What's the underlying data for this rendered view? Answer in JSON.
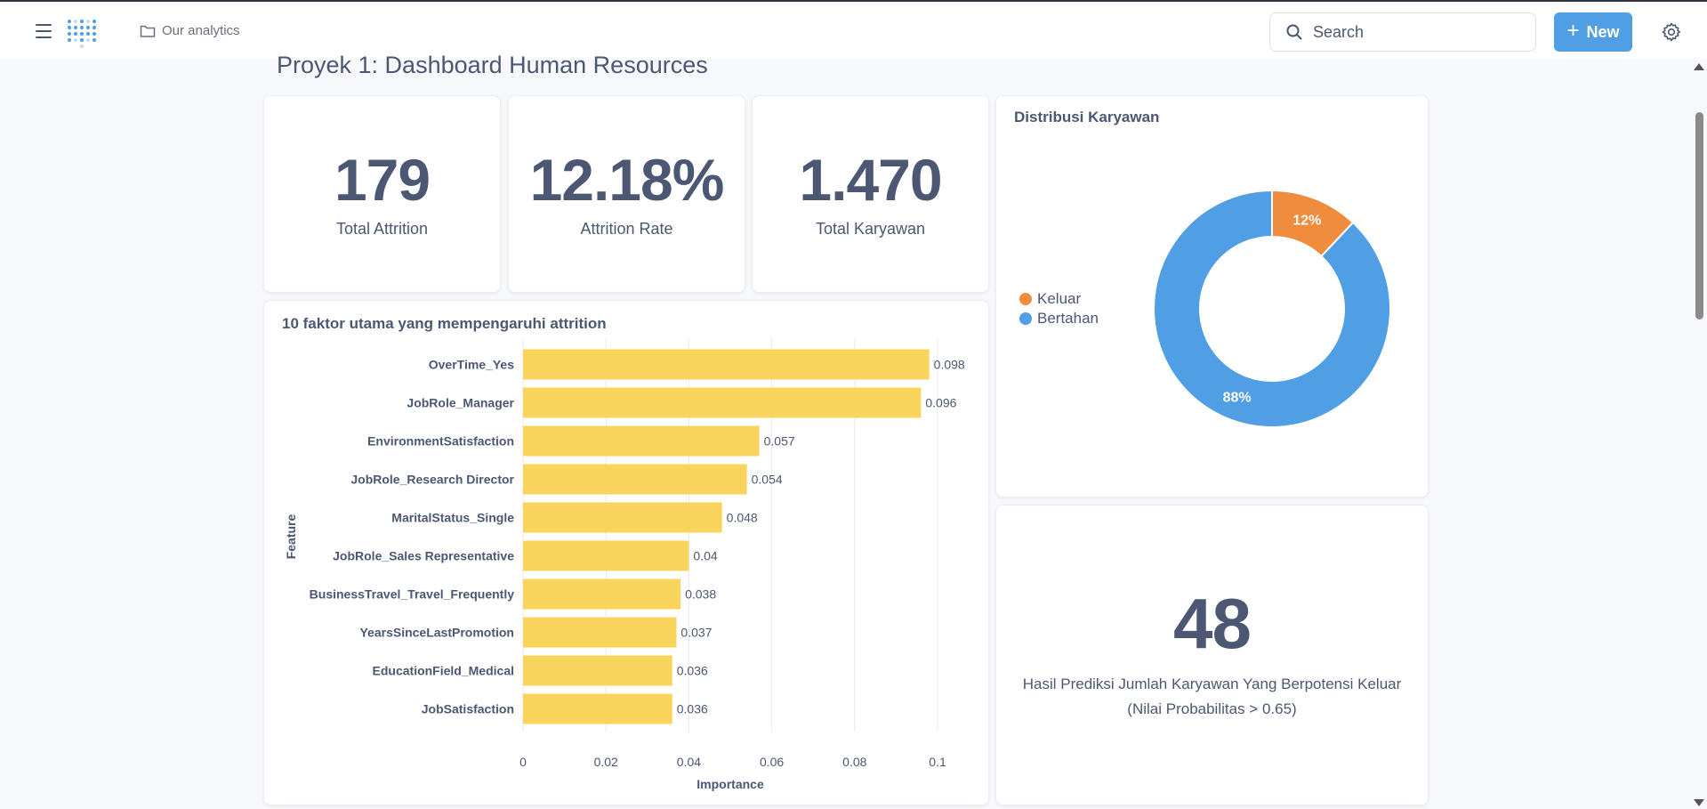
{
  "topbar": {
    "breadcrumb": "Our analytics",
    "search_placeholder": "Search",
    "new_label": "New"
  },
  "dashboard": {
    "title": "Proyek 1: Dashboard Human Resources"
  },
  "kpis": [
    {
      "value": "179",
      "label": "Total Attrition"
    },
    {
      "value": "12.18%",
      "label": "Attrition Rate"
    },
    {
      "value": "1.470",
      "label": "Total Karyawan"
    }
  ],
  "prediction": {
    "value": "48",
    "label_line1": "Hasil Prediksi Jumlah Karyawan Yang Berpotensi Keluar",
    "label_line2": "(Nilai Probabilitas > 0.65)"
  },
  "colors": {
    "bar": "#f9d45c",
    "keluar": "#f08c3d",
    "bertahan": "#509ee3",
    "accent": "#509ee3",
    "text": "#4c5773"
  },
  "chart_data": [
    {
      "type": "bar",
      "orientation": "horizontal",
      "title": "10 faktor utama yang mempengaruhi attrition",
      "xlabel": "Importance",
      "ylabel": "Feature",
      "xlim": [
        0,
        0.1
      ],
      "xticks": [
        "0",
        "0.02",
        "0.04",
        "0.06",
        "0.08",
        "0.1"
      ],
      "grid": true,
      "categories": [
        "OverTime_Yes",
        "JobRole_Manager",
        "EnvironmentSatisfaction",
        "JobRole_Research Director",
        "MaritalStatus_Single",
        "JobRole_Sales Representative",
        "BusinessTravel_Travel_Frequently",
        "YearsSinceLastPromotion",
        "EducationField_Medical",
        "JobSatisfaction"
      ],
      "values": [
        0.098,
        0.096,
        0.057,
        0.054,
        0.048,
        0.04,
        0.038,
        0.037,
        0.036,
        0.036
      ],
      "value_labels": [
        "0.098",
        "0.096",
        "0.057",
        "0.054",
        "0.048",
        "0.04",
        "0.038",
        "0.037",
        "0.036",
        "0.036"
      ]
    },
    {
      "type": "pie",
      "donut": true,
      "title": "Distribusi Karyawan",
      "legend_position": "left",
      "slices": [
        {
          "name": "Keluar",
          "value": 12,
          "label": "12%"
        },
        {
          "name": "Bertahan",
          "value": 88,
          "label": "88%"
        }
      ]
    }
  ]
}
